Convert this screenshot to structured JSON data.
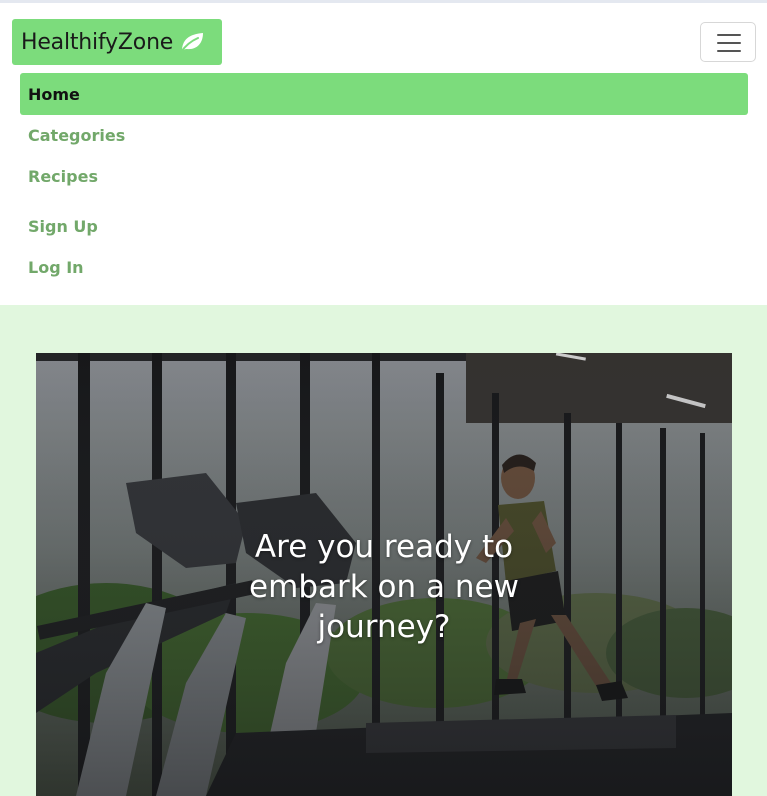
{
  "brand": {
    "name": "HealthifyZone",
    "icon": "leaf-icon"
  },
  "nav": {
    "toggle_icon": "hamburger-icon",
    "items": [
      {
        "label": "Home",
        "active": true
      },
      {
        "label": "Categories",
        "active": false
      },
      {
        "label": "Recipes",
        "active": false
      },
      {
        "label": "Sign Up",
        "active": false
      },
      {
        "label": "Log In",
        "active": false
      }
    ]
  },
  "hero": {
    "headline": "Are you ready to embark on a new journey?"
  },
  "colors": {
    "brand_green": "#7cdc7c",
    "link_green": "#72a86a",
    "hero_background": "#e1f7de"
  }
}
